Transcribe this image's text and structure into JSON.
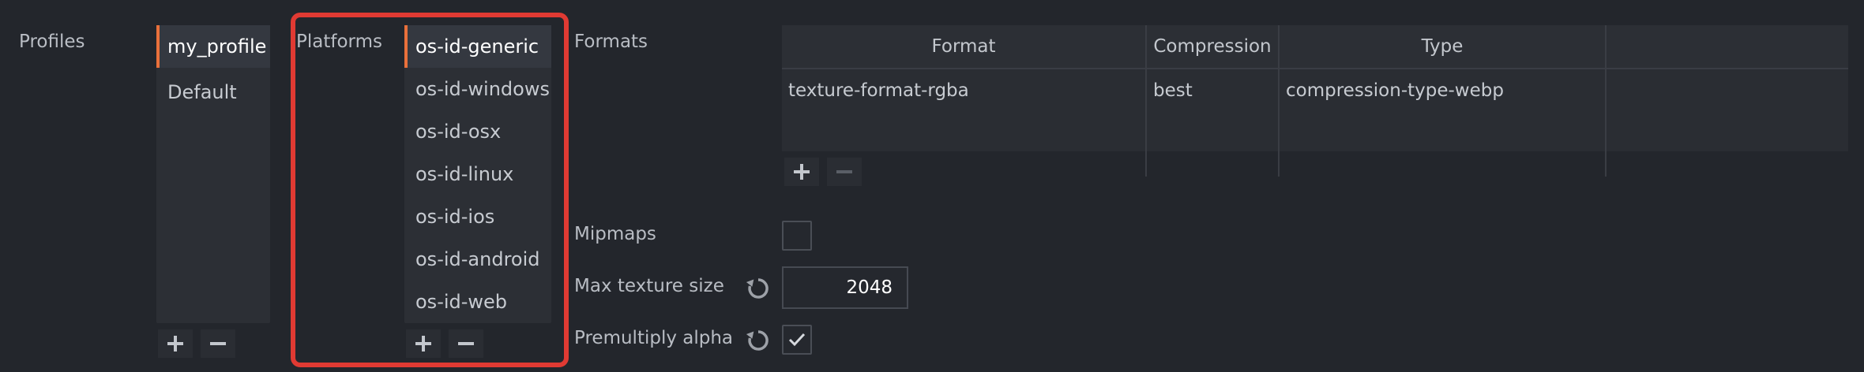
{
  "profiles": {
    "label": "Profiles",
    "items": [
      {
        "label": "my_profile",
        "selected": true
      },
      {
        "label": "Default",
        "selected": false
      }
    ]
  },
  "platforms": {
    "label": "Platforms",
    "items": [
      {
        "label": "os-id-generic",
        "selected": true
      },
      {
        "label": "os-id-windows",
        "selected": false
      },
      {
        "label": "os-id-osx",
        "selected": false
      },
      {
        "label": "os-id-linux",
        "selected": false
      },
      {
        "label": "os-id-ios",
        "selected": false
      },
      {
        "label": "os-id-android",
        "selected": false
      },
      {
        "label": "os-id-web",
        "selected": false
      }
    ]
  },
  "formats": {
    "label": "Formats",
    "columns": [
      "Format",
      "Compression",
      "Type"
    ],
    "rows": [
      [
        "texture-format-rgba",
        "best",
        "compression-type-webp"
      ]
    ]
  },
  "settings": {
    "mipmaps_label": "Mipmaps",
    "mipmaps_checked": false,
    "max_texture_size_label": "Max texture size",
    "max_texture_size_value": "2048",
    "premultiply_alpha_label": "Premultiply alpha",
    "premultiply_alpha_checked": true
  },
  "colors": {
    "background": "#23262c",
    "accent": "#e9703b",
    "highlight": "#e03a33"
  },
  "icons": {
    "add": "plus-icon",
    "remove": "minus-icon",
    "reset": "reset-icon",
    "check": "check-icon"
  }
}
